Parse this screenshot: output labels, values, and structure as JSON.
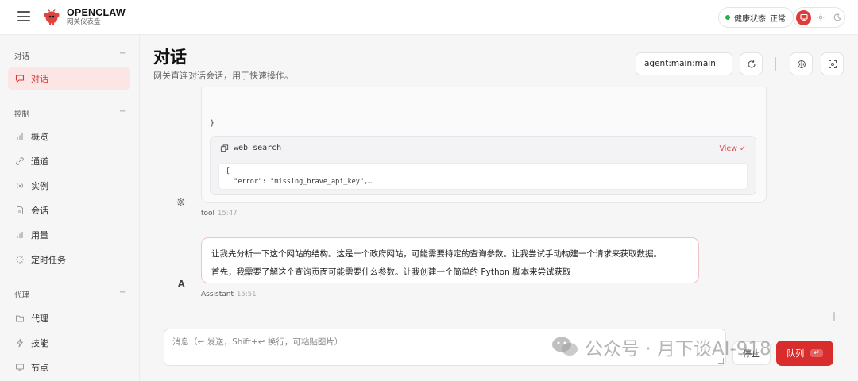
{
  "app": {
    "title": "OPENCLAW",
    "subtitle": "网关仪表盘",
    "health_label": "健康状态",
    "health_value": "正常"
  },
  "sidebar": {
    "sections": [
      {
        "label": "对话",
        "items": [
          {
            "label": "对话",
            "icon": "chat-icon",
            "active": true
          }
        ]
      },
      {
        "label": "控制",
        "items": [
          {
            "label": "概览",
            "icon": "bar-chart-icon"
          },
          {
            "label": "通道",
            "icon": "link-icon"
          },
          {
            "label": "实例",
            "icon": "radio-icon"
          },
          {
            "label": "会话",
            "icon": "document-icon"
          },
          {
            "label": "用量",
            "icon": "bar-chart-icon"
          },
          {
            "label": "定时任务",
            "icon": "loader-icon"
          }
        ]
      },
      {
        "label": "代理",
        "items": [
          {
            "label": "代理",
            "icon": "folder-icon"
          },
          {
            "label": "技能",
            "icon": "zap-icon"
          },
          {
            "label": "节点",
            "icon": "monitor-icon"
          }
        ]
      }
    ],
    "collapse_symbol": "−"
  },
  "main": {
    "title": "对话",
    "subtitle": "网关直连对话会话，用于快速操作。",
    "session_key": "agent:main:main"
  },
  "chat": {
    "brace": "}",
    "tool_call": {
      "name": "web_search",
      "view_label": "View ✓",
      "code": "{\n  \"error\": \"missing_brave_api_key\",…"
    },
    "tool_meta": {
      "sender": "tool",
      "time": "15:47"
    },
    "assistant_lines": [
      "让我先分析一下这个网站的结构。这是一个政府网站，可能需要特定的查询参数。让我尝试手动构建一个请求来获取数据。",
      "首先，我需要了解这个查询页面可能需要什么参数。让我创建一个简单的 Python 脚本来尝试获取"
    ],
    "assistant_avatar": "A",
    "assistant_meta": {
      "sender": "Assistant",
      "time": "15:51"
    }
  },
  "composer": {
    "placeholder": "消息（↩ 发送，Shift+↩ 换行，可粘贴图片）",
    "stop_label": "停止",
    "queue_label": "队列",
    "queue_kbd": "↵"
  },
  "watermark": {
    "text": "公众号 · 月下谈AI-918"
  },
  "colors": {
    "accent": "#d92d2d",
    "active_bg": "#fbe5e5",
    "health": "#22b24c"
  }
}
